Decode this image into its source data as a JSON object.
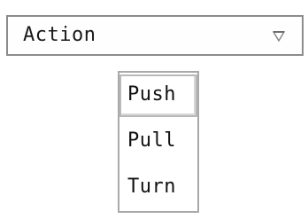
{
  "combo": {
    "selected_value": "Action",
    "arrow_icon": "triangle-down-icon"
  },
  "menu": {
    "items": [
      {
        "label": "Push",
        "selected": true
      },
      {
        "label": "Pull",
        "selected": false
      },
      {
        "label": "Turn",
        "selected": false
      }
    ]
  },
  "colors": {
    "border": "#8c8c8c",
    "menu_border": "#a9a9a9",
    "arrow": "#8a8a8a",
    "text": "#1a1a1a"
  }
}
